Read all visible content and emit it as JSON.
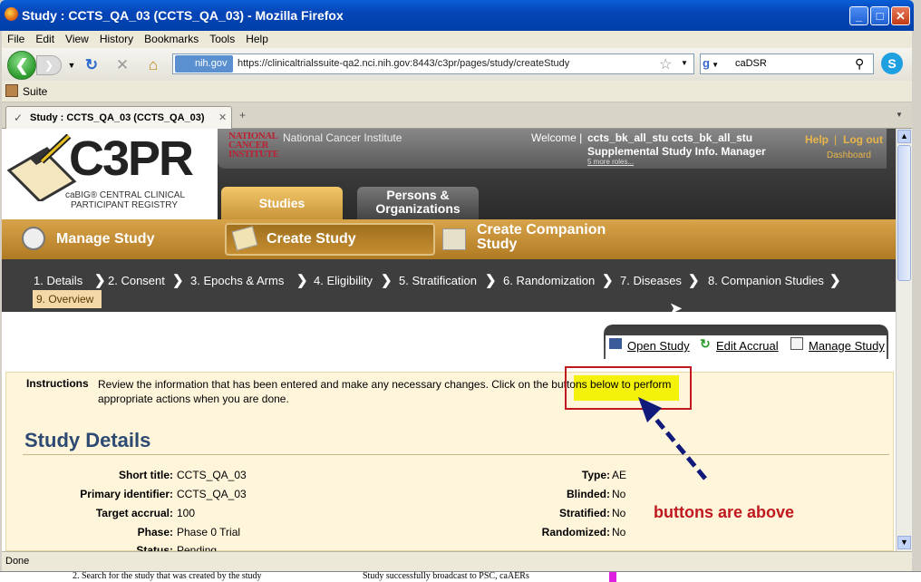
{
  "window": {
    "title": "Study : CCTS_QA_03 (CCTS_QA_03) - Mozilla Firefox",
    "min": "_",
    "max": "□",
    "close": "✕"
  },
  "menu": [
    "File",
    "Edit",
    "View",
    "History",
    "Bookmarks",
    "Tools",
    "Help"
  ],
  "nav": {
    "site": "nih.gov",
    "url": "https://clinicaltrialssuite-qa2.nci.nih.gov:8443/c3pr/pages/study/createStudy",
    "search_value": "caDSR"
  },
  "bookmarks": {
    "item": "Suite"
  },
  "tab": {
    "title": "Study : CCTS_QA_03 (CCTS_QA_03)",
    "new_tab": "+"
  },
  "app": {
    "logo_text": "C3PR",
    "logo_sub1": "caBIG® CENTRAL CLINICAL",
    "logo_sub2": "PARTICIPANT REGISTRY",
    "nci_logo": "NATIONAL CANCER INSTITUTE",
    "nci_name": "National Cancer Institute",
    "welcome": "Welcome |",
    "username": "ccts_bk_all_stu ccts_bk_all_stu",
    "role": "Supplemental Study Info. Manager",
    "more_roles": "5 more roles...",
    "help": "Help",
    "sep": "|",
    "logout": "Log out",
    "dashboard": "Dashboard",
    "tabs": [
      "Studies",
      "Persons & Organizations"
    ],
    "menu_items": [
      "Manage Study",
      "Create Study",
      "Create Companion Study"
    ],
    "steps": [
      "1. Details",
      "2. Consent",
      "3. Epochs & Arms",
      "4. Eligibility",
      "5. Stratification",
      "6. Randomization",
      "7. Diseases",
      "8. Companion Studies",
      "9. Overview"
    ],
    "actions": [
      "Open Study",
      "Edit Accrual",
      "Manage Study"
    ],
    "instructions_label": "Instructions",
    "instructions_line1": "Review the information that has been entered and make any necessary changes. Click on the buttons below to perform",
    "instructions_line2": "appropriate actions when you are done.",
    "highlight_text": "buttons below to",
    "section_title": "Study Details",
    "left_fields": [
      {
        "label": "Short title:",
        "value": "CCTS_QA_03"
      },
      {
        "label": "Primary identifier:",
        "value": "CCTS_QA_03"
      },
      {
        "label": "Target accrual:",
        "value": "100"
      },
      {
        "label": "Phase:",
        "value": "Phase 0 Trial"
      },
      {
        "label": "Status:",
        "value": "Pending"
      }
    ],
    "right_fields": [
      {
        "label": "Type:",
        "value": "AE"
      },
      {
        "label": "Blinded:",
        "value": "No"
      },
      {
        "label": "Stratified:",
        "value": "No"
      },
      {
        "label": "Randomized:",
        "value": "No"
      }
    ],
    "annotation": "buttons are above"
  },
  "status": "Done",
  "bottom_text": [
    "2. Search for the study that was created by the study",
    "Study successfully broadcast to PSC, caAERs"
  ],
  "colors": {
    "accent": "#c8953a",
    "annotation_red": "#c0181f",
    "arrow_blue": "#101a7a",
    "highlight": "#f4f20a"
  }
}
